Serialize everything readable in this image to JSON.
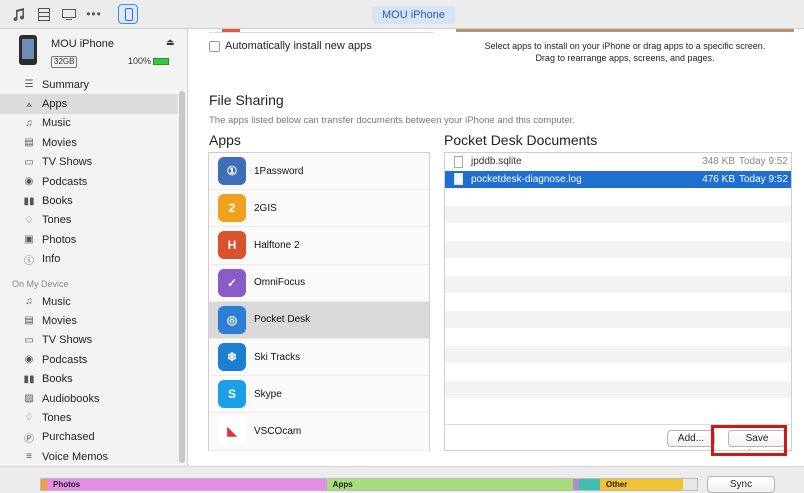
{
  "toolbar": {
    "icons": [
      "music-icon",
      "film-icon",
      "tv-icon",
      "more-icon",
      "iphone-icon"
    ],
    "device_pill": "MOU iPhone"
  },
  "device": {
    "name": "MOU iPhone",
    "capacity": "32GB",
    "battery": "100%"
  },
  "sidebar": {
    "settings_items": [
      {
        "label": "Summary",
        "icon": "summary-icon"
      },
      {
        "label": "Apps",
        "icon": "apps-icon",
        "active": true
      },
      {
        "label": "Music",
        "icon": "music-icon"
      },
      {
        "label": "Movies",
        "icon": "movies-icon"
      },
      {
        "label": "TV Shows",
        "icon": "tv-icon"
      },
      {
        "label": "Podcasts",
        "icon": "podcasts-icon"
      },
      {
        "label": "Books",
        "icon": "books-icon"
      },
      {
        "label": "Tones",
        "icon": "bell-icon"
      },
      {
        "label": "Photos",
        "icon": "camera-icon"
      },
      {
        "label": "Info",
        "icon": "info-icon"
      }
    ],
    "section_label": "On My Device",
    "device_items": [
      {
        "label": "Music",
        "icon": "music-icon"
      },
      {
        "label": "Movies",
        "icon": "movies-icon"
      },
      {
        "label": "TV Shows",
        "icon": "tv-icon"
      },
      {
        "label": "Podcasts",
        "icon": "podcasts-icon"
      },
      {
        "label": "Books",
        "icon": "books-icon"
      },
      {
        "label": "Audiobooks",
        "icon": "audiobooks-icon"
      },
      {
        "label": "Tones",
        "icon": "bell-icon"
      },
      {
        "label": "Purchased",
        "icon": "purchased-icon"
      },
      {
        "label": "Voice Memos",
        "icon": "voice-memos-icon"
      }
    ]
  },
  "main": {
    "auto_install_label": "Automatically install new apps",
    "screens_note_line1": "Select apps to install on your iPhone or drag apps to a specific screen.",
    "screens_note_line2": "Drag to rearrange apps, screens, and pages.",
    "file_sharing_title": "File Sharing",
    "file_sharing_desc": "The apps listed below can transfer documents between your iPhone and this computer.",
    "apps_title": "Apps",
    "docs_title": "Pocket Desk Documents",
    "apps": [
      {
        "label": "1Password",
        "icon": "onepassword-icon",
        "color": "#3f6fb6",
        "glyph": "①"
      },
      {
        "label": "2GIS",
        "icon": "2gis-icon",
        "color": "#f0a21f",
        "glyph": "2"
      },
      {
        "label": "Halftone 2",
        "icon": "halftone-icon",
        "color": "#d9522b",
        "glyph": "H"
      },
      {
        "label": "OmniFocus",
        "icon": "omnifocus-icon",
        "color": "#8b5cc7",
        "glyph": "✓"
      },
      {
        "label": "Pocket Desk",
        "icon": "pocket-desk-icon",
        "color": "#2c7fd5",
        "glyph": "◎",
        "selected": true
      },
      {
        "label": "Ski Tracks",
        "icon": "ski-tracks-icon",
        "color": "#1d7fd1",
        "glyph": "❄"
      },
      {
        "label": "Skype",
        "icon": "skype-icon",
        "color": "#1aa0e8",
        "glyph": "S"
      },
      {
        "label": "VSCOcam",
        "icon": "vscocam-icon",
        "color": "#ffffff",
        "glyph": "◣"
      }
    ],
    "documents": [
      {
        "name": "jpddb.sqlite",
        "size": "348 KB",
        "date": "Today 9:52"
      },
      {
        "name": "pocketdesk-diagnose.log",
        "size": "476 KB",
        "date": "Today 9:52",
        "selected": true
      }
    ],
    "add_label": "Add...",
    "save_label": "Save to..."
  },
  "capacity_bar": {
    "segments": [
      {
        "label": "",
        "color": "#f0a040",
        "fraction": 0.004
      },
      {
        "label": "Photos",
        "color": "#e58ce9",
        "fraction": 0.43
      },
      {
        "label": "Apps",
        "color": "#a6dc7a",
        "fraction": 0.378
      },
      {
        "label": "",
        "color": "#b58bd2",
        "fraction": 0.006
      },
      {
        "label": "",
        "color": "#3fbfad",
        "fraction": 0.033
      },
      {
        "label": "Other",
        "color": "#f2c232",
        "fraction": 0.128
      },
      {
        "label": "",
        "color": "#e7e7e7",
        "fraction": 0.021
      }
    ]
  },
  "sync_label": "Sync"
}
